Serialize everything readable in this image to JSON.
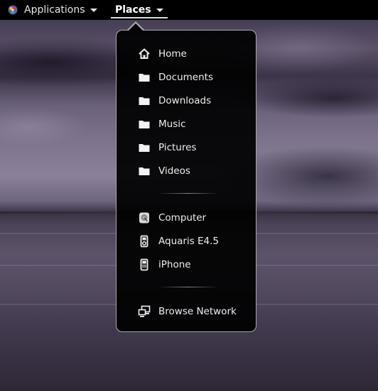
{
  "topbar": {
    "applications_label": "Applications",
    "places_label": "Places"
  },
  "places_menu": {
    "bookmarks": [
      {
        "label": "Home",
        "icon": "home-icon"
      },
      {
        "label": "Documents",
        "icon": "folder-icon"
      },
      {
        "label": "Downloads",
        "icon": "folder-icon"
      },
      {
        "label": "Music",
        "icon": "folder-icon"
      },
      {
        "label": "Pictures",
        "icon": "folder-icon"
      },
      {
        "label": "Videos",
        "icon": "folder-icon"
      }
    ],
    "devices": [
      {
        "label": "Computer",
        "icon": "hard-disk-icon"
      },
      {
        "label": "Aquaris E4.5",
        "icon": "media-player-icon"
      },
      {
        "label": "iPhone",
        "icon": "phone-icon"
      }
    ],
    "network": [
      {
        "label": "Browse Network",
        "icon": "network-icon"
      }
    ]
  },
  "colors": {
    "topbar_bg": "#000000",
    "menu_bg": "#000000",
    "menu_border": "#a8a8a8",
    "text": "#eeeeee"
  }
}
